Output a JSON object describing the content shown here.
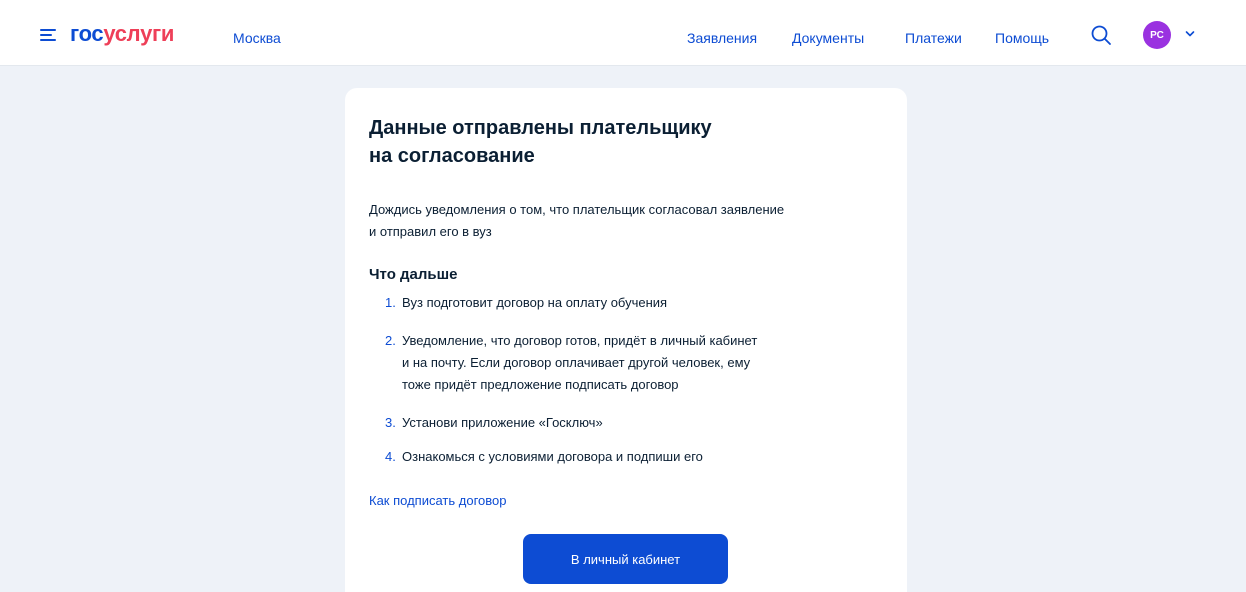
{
  "header": {
    "logo_part1": "гос",
    "logo_part2": "услуги",
    "city": "Москва",
    "nav": [
      "Заявления",
      "Документы",
      "Платежи",
      "Помощь"
    ],
    "avatar_initials": "РС"
  },
  "main": {
    "title_line1": "Данные отправлены плательщику",
    "title_line2": "на согласование",
    "desc_line1": "Дождись уведомления о том, что плательщик согласовал заявление",
    "desc_line2": "и отправил его в вуз",
    "next_heading": "Что дальше",
    "steps": [
      {
        "num": "1.",
        "lines": [
          "Вуз подготовит договор на оплату обучения"
        ]
      },
      {
        "num": "2.",
        "lines": [
          "Уведомление, что договор готов, придёт в личный кабинет",
          "и на почту. Если договор оплачивает другой человек, ему",
          "тоже придёт предложение подписать договор"
        ]
      },
      {
        "num": "3.",
        "lines": [
          "Установи приложение «Госключ»"
        ]
      },
      {
        "num": "4.",
        "lines": [
          "Ознакомься с условиями договора и подпиши его"
        ]
      }
    ],
    "howto_link": "Как подписать договор",
    "cta_label": "В личный кабинет"
  },
  "colors": {
    "accent": "#0d4cd3",
    "logo_red": "#ee3f58",
    "avatar": "#9a32e0",
    "background": "#eef2f8"
  }
}
